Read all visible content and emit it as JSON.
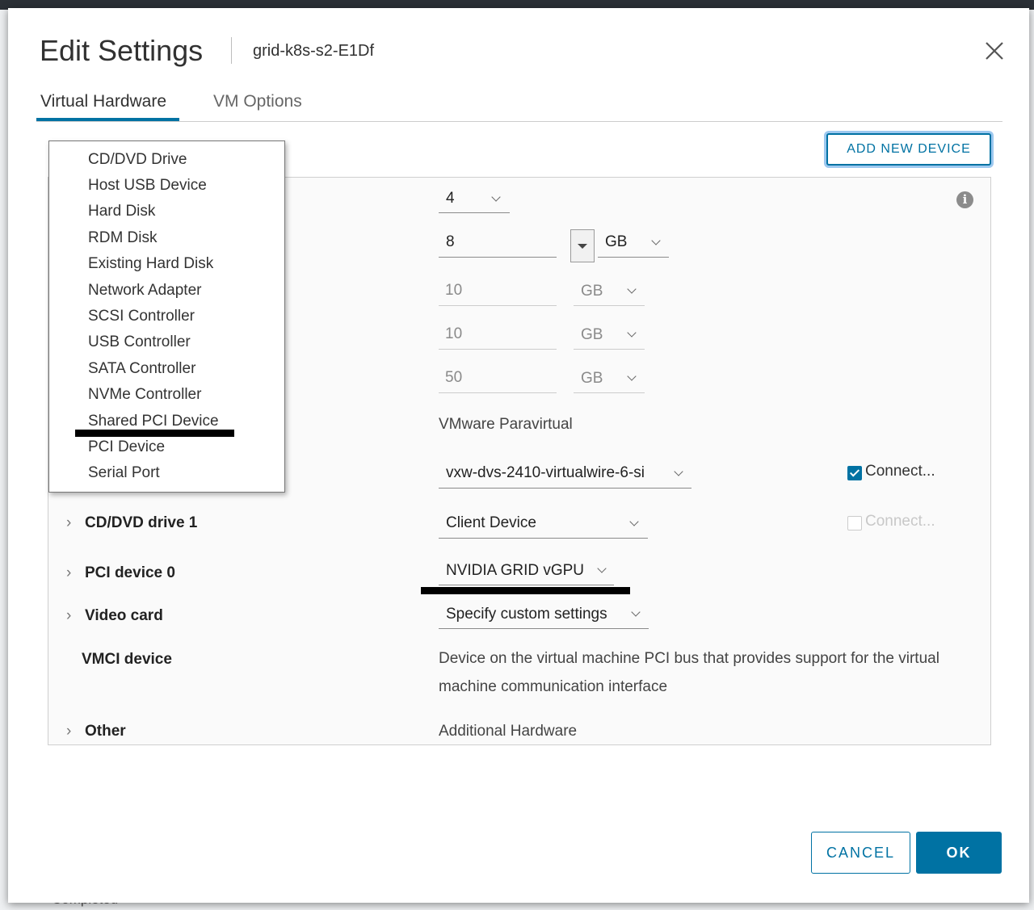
{
  "dialog": {
    "title": "Edit Settings",
    "subtitle": "grid-k8s-s2-E1Df",
    "close_icon": "close-icon"
  },
  "tabs": [
    {
      "label": "Virtual Hardware",
      "active": true
    },
    {
      "label": "VM Options",
      "active": false
    }
  ],
  "add_device_label": "ADD NEW DEVICE",
  "menu": {
    "items": [
      "CD/DVD Drive",
      "Host USB Device",
      "Hard Disk",
      "RDM Disk",
      "Existing Hard Disk",
      "Network Adapter",
      "SCSI Controller",
      "USB Controller",
      "SATA Controller",
      "NVMe Controller",
      "Shared PCI Device",
      "PCI Device",
      "Serial Port"
    ]
  },
  "rows": {
    "cpu": {
      "value": "4"
    },
    "memory": {
      "value": "8",
      "unit": "GB"
    },
    "disk1": {
      "value": "10",
      "unit": "GB"
    },
    "disk2": {
      "value": "10",
      "unit": "GB"
    },
    "disk3": {
      "value": "50",
      "unit": "GB"
    },
    "scsi": {
      "value": "VMware Paravirtual"
    },
    "network": {
      "value": "vxw-dvs-2410-virtualwire-6-si",
      "connect_label": "Connect...",
      "connected": true
    },
    "cddvd": {
      "label": "CD/DVD drive 1",
      "value": "Client Device",
      "connect_label": "Connect...",
      "connected": false
    },
    "pci": {
      "label": "PCI device 0",
      "value": "NVIDIA GRID vGPU"
    },
    "video": {
      "label": "Video card",
      "value": "Specify custom settings"
    },
    "vmci": {
      "label": "VMCI device",
      "description": "Device on the virtual machine PCI bus that provides support for the virtual machine communication interface"
    },
    "other": {
      "label": "Other",
      "value": "Additional Hardware"
    }
  },
  "footer": {
    "cancel_label": "CANCEL",
    "ok_label": "OK"
  },
  "background_peek": {
    "status_text": "Completed"
  },
  "colors": {
    "accent": "#0072a3",
    "focus_ring": "#9dc8ef",
    "redaction": "#000000"
  }
}
